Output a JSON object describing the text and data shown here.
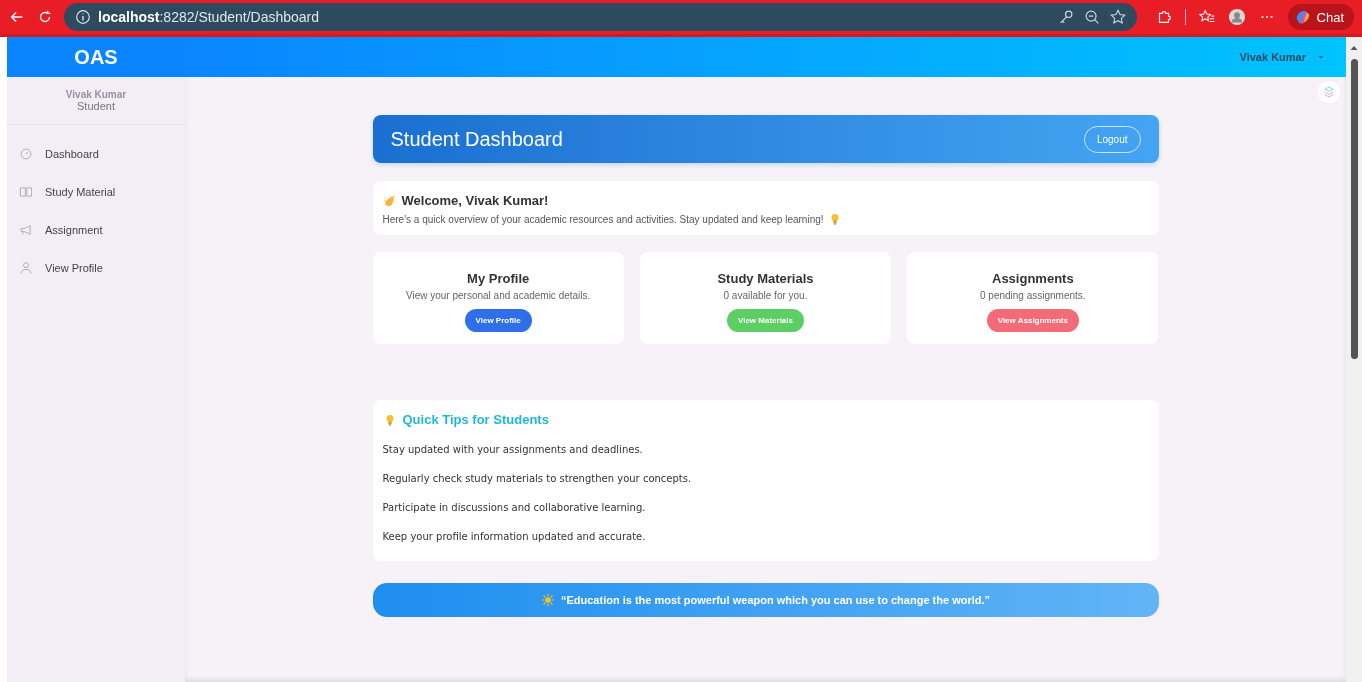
{
  "browser": {
    "url_host": "localhost",
    "url_path": ":8282/Student/Dashboard",
    "chat_label": "Chat"
  },
  "sidebar": {
    "brand": "OAS",
    "user_name": "Vivak Kumar",
    "user_role": "Student",
    "items": [
      {
        "label": "Dashboard",
        "selected": false
      },
      {
        "label": "Study Material",
        "selected": false
      },
      {
        "label": "Assignment",
        "selected": false
      },
      {
        "label": "View Profile",
        "selected": false
      }
    ]
  },
  "topbar": {
    "user_menu": "Vivak Kumar"
  },
  "header": {
    "title": "Student Dashboard",
    "logout": "Logout"
  },
  "welcome": {
    "title": "Welcome, Vivak Kumar!",
    "text": "Here's a quick overview of your academic resources and activities. Stay updated and keep learning!"
  },
  "cards": [
    {
      "title": "My Profile",
      "text": "View your personal and academic details.",
      "button": "View Profile",
      "color": "#2f6fe8"
    },
    {
      "title": "Study Materials",
      "text": "0 available for you.",
      "button": "View Materials",
      "color": "#5bcf63"
    },
    {
      "title": "Assignments",
      "text": "0 pending assignments.",
      "button": "View Assignments",
      "color": "#f46b78"
    }
  ],
  "tips": {
    "title": "Quick Tips for Students",
    "items": [
      "Stay updated with your assignments and deadlines.",
      "Regularly check study materials to strengthen your concepts.",
      "Participate in discussions and collaborative learning.",
      "Keep your profile information updated and accurate."
    ]
  },
  "quote": "“Education is the most powerful weapon which you can use to change the world.”"
}
